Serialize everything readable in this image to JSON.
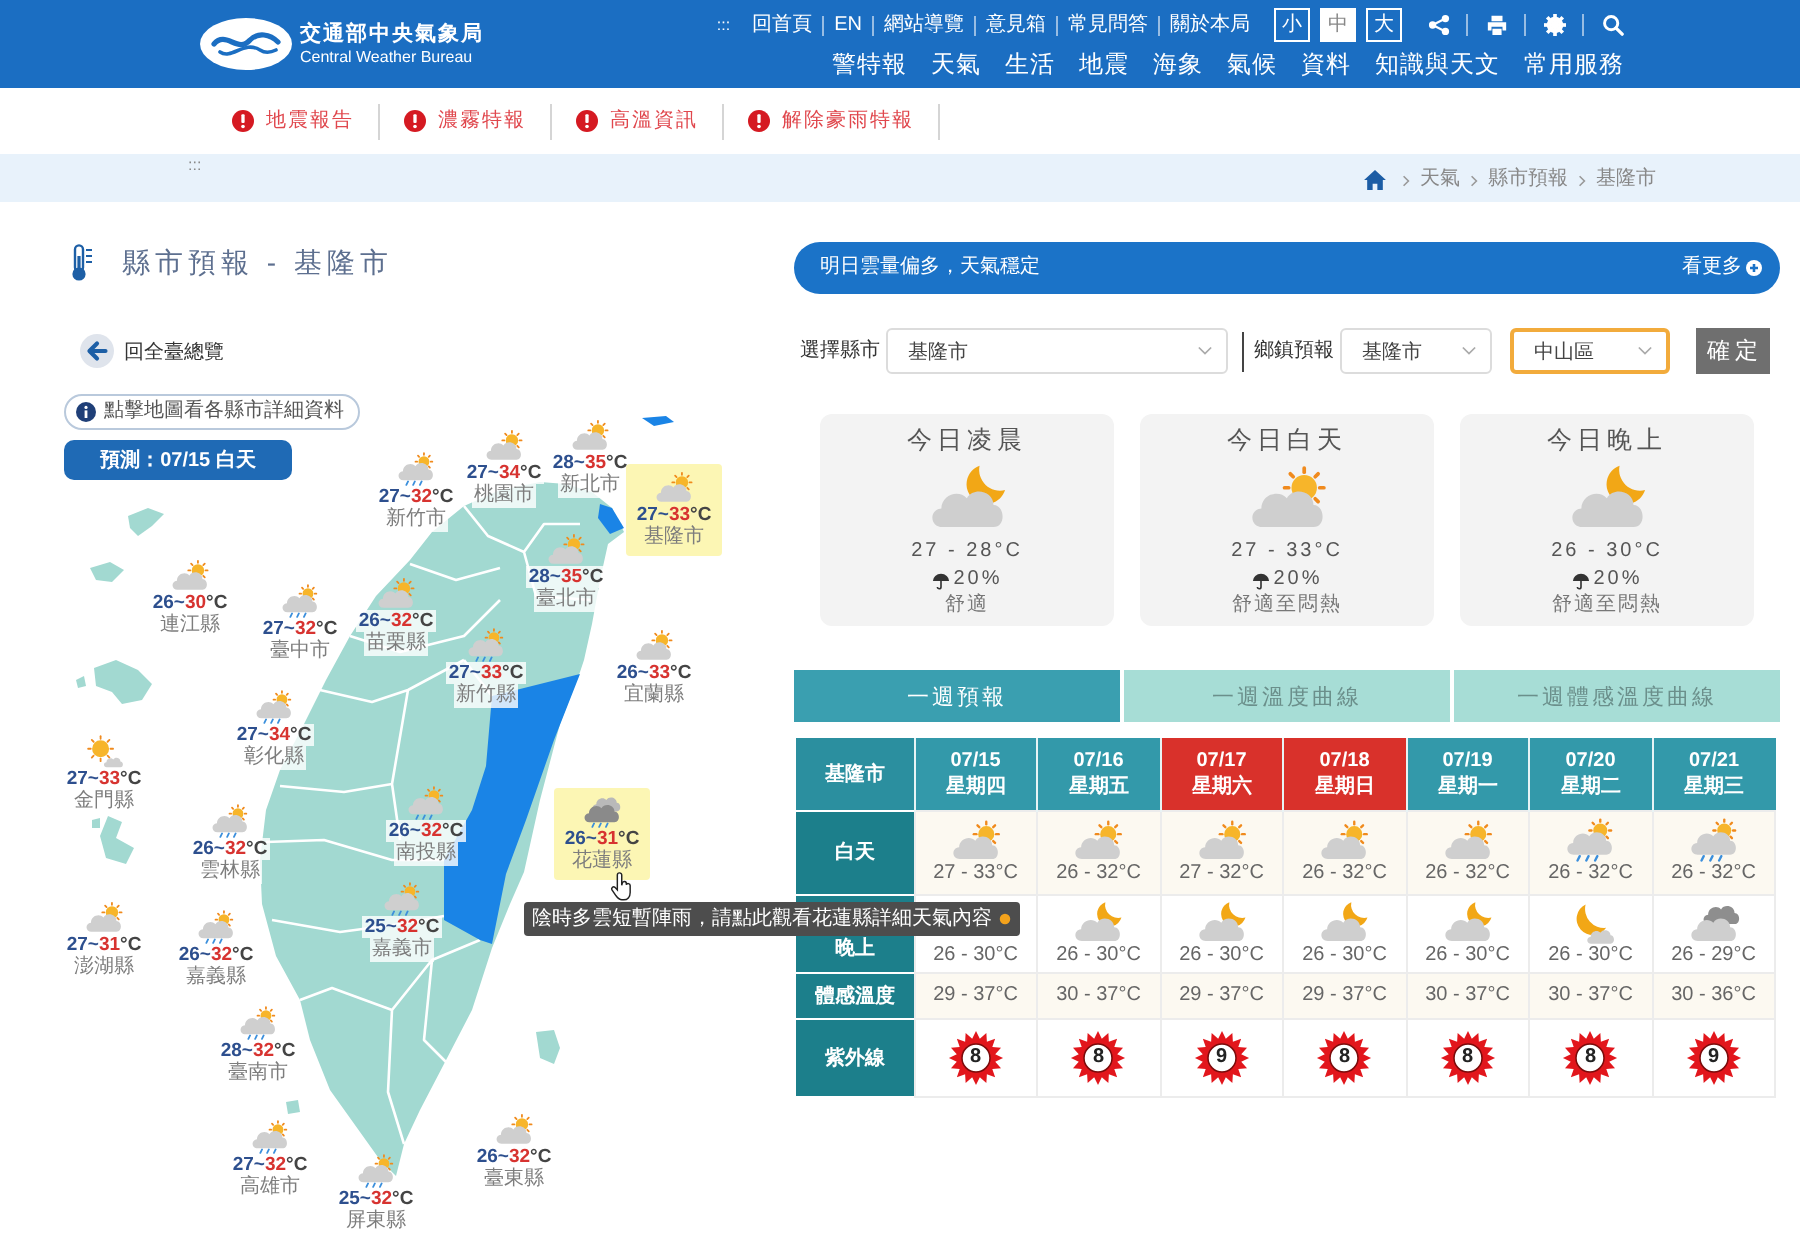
{
  "header": {
    "logo": {
      "name": "交通部中央氣象局",
      "name_en": "Central Weather Bureau"
    },
    "anchor": ":::",
    "utility_links": [
      "回首頁",
      "EN",
      "網站導覽",
      "意見箱",
      "常見問答",
      "關於本局"
    ],
    "font_sizes": [
      {
        "label": "小",
        "selected": false
      },
      {
        "label": "中",
        "selected": true
      },
      {
        "label": "大",
        "selected": false
      }
    ],
    "nav": [
      "警特報",
      "天氣",
      "生活",
      "地震",
      "海象",
      "氣候",
      "資料",
      "知識與天文",
      "常用服務"
    ]
  },
  "alerts": [
    "地震報告",
    "濃霧特報",
    "高溫資訊",
    "解除豪雨特報"
  ],
  "breadcrumb": {
    "anchor": ":::",
    "items": [
      "天氣",
      "縣市預報",
      "基隆市"
    ]
  },
  "county_panel": {
    "title": "縣市預報 - 基隆市",
    "back_link": "回全臺總覽",
    "hint": "點擊地圖看各縣市詳細資料",
    "forecast_time": "預測：07/15 白天"
  },
  "map": {
    "counties": [
      {
        "name": "桃園市",
        "kind": "sun-cloud",
        "low": "27~",
        "high": "34",
        "unit": "°C",
        "highlighted": false
      },
      {
        "name": "新北市",
        "kind": "sun-cloud",
        "low": "28~",
        "high": "35",
        "unit": "°C",
        "highlighted": false
      },
      {
        "name": "新竹市",
        "kind": "rain",
        "low": "27~",
        "high": "32",
        "unit": "°C",
        "highlighted": false
      },
      {
        "name": "基隆市",
        "kind": "sun-cloud",
        "low": "27~",
        "high": "33",
        "unit": "°C",
        "highlighted": true
      },
      {
        "name": "臺北市",
        "kind": "sun-cloud",
        "low": "28~",
        "high": "35",
        "unit": "°C",
        "highlighted": false
      },
      {
        "name": "連江縣",
        "kind": "sun-cloud",
        "low": "26~",
        "high": "30",
        "unit": "°C",
        "highlighted": false
      },
      {
        "name": "臺中市",
        "kind": "rain",
        "low": "27~",
        "high": "32",
        "unit": "°C",
        "highlighted": false
      },
      {
        "name": "苗栗縣",
        "kind": "sun-cloud",
        "low": "26~",
        "high": "32",
        "unit": "°C",
        "highlighted": false
      },
      {
        "name": "新竹縣",
        "kind": "rain",
        "low": "27~",
        "high": "33",
        "unit": "°C",
        "highlighted": false
      },
      {
        "name": "宜蘭縣",
        "kind": "sun-cloud",
        "low": "26~",
        "high": "33",
        "unit": "°C",
        "highlighted": false
      },
      {
        "name": "彰化縣",
        "kind": "rain",
        "low": "27~",
        "high": "34",
        "unit": "°C",
        "highlighted": false
      },
      {
        "name": "金門縣",
        "kind": "sunny",
        "low": "27~",
        "high": "33",
        "unit": "°C",
        "highlighted": false
      },
      {
        "name": "雲林縣",
        "kind": "rain",
        "low": "26~",
        "high": "32",
        "unit": "°C",
        "highlighted": false
      },
      {
        "name": "南投縣",
        "kind": "rain",
        "low": "26~",
        "high": "32",
        "unit": "°C",
        "highlighted": false
      },
      {
        "name": "花蓮縣",
        "kind": "shower",
        "low": "26~",
        "high": "31",
        "unit": "°C",
        "highlighted": true
      },
      {
        "name": "澎湖縣",
        "kind": "sun-cloud",
        "low": "27~",
        "high": "31",
        "unit": "°C",
        "highlighted": false
      },
      {
        "name": "嘉義市",
        "kind": "rain",
        "low": "25~",
        "high": "32",
        "unit": "°C",
        "highlighted": false
      },
      {
        "name": "嘉義縣",
        "kind": "rain",
        "low": "26~",
        "high": "32",
        "unit": "°C",
        "highlighted": false
      },
      {
        "name": "臺南市",
        "kind": "rain",
        "low": "28~",
        "high": "32",
        "unit": "°C",
        "highlighted": false
      },
      {
        "name": "高雄市",
        "kind": "rain",
        "low": "27~",
        "high": "32",
        "unit": "°C",
        "highlighted": false
      },
      {
        "name": "臺東縣",
        "kind": "sun-cloud",
        "low": "26~",
        "high": "32",
        "unit": "°C",
        "highlighted": false
      },
      {
        "name": "屏東縣",
        "kind": "rain",
        "low": "25~",
        "high": "32",
        "unit": "°C",
        "highlighted": false
      }
    ],
    "tooltip": "陰時多雲短暫陣雨，請點此觀看花蓮縣詳細天氣內容"
  },
  "summary": {
    "text": "明日雲量偏多，天氣穩定",
    "more": "看更多"
  },
  "filters": {
    "county_label": "選擇縣市",
    "county": "基隆市",
    "town_label": "鄉鎮預報",
    "town_county": "基隆市",
    "town": "中山區",
    "town_focused": true,
    "submit": "確定"
  },
  "today": [
    {
      "title": "今日凌晨",
      "kind": "moon-cloud",
      "temp": "27 - 28°C",
      "rain": "20%",
      "comfort": "舒適"
    },
    {
      "title": "今日白天",
      "kind": "sun-cloud",
      "temp": "27 - 33°C",
      "rain": "20%",
      "comfort": "舒適至悶熱"
    },
    {
      "title": "今日晚上",
      "kind": "moon-cloud",
      "temp": "26 - 30°C",
      "rain": "20%",
      "comfort": "舒適至悶熱"
    }
  ],
  "week": {
    "tabs": [
      {
        "label": "一週預報",
        "selected": true
      },
      {
        "label": "一週溫度曲線",
        "selected": false
      },
      {
        "label": "一週體感溫度曲線",
        "selected": false
      }
    ],
    "table": {
      "corner": "基隆市",
      "row_labels": [
        "白天",
        "晚上",
        "體感溫度",
        "紫外線"
      ],
      "days": [
        {
          "date": "07/15",
          "weekday": "星期四",
          "weekend": false,
          "day": {
            "kind": "sun-cloud",
            "temp": "27 - 33°C"
          },
          "night": {
            "temp": "26 - 30°C"
          },
          "feels": "29 - 37°C",
          "uv": "8"
        },
        {
          "date": "07/16",
          "weekday": "星期五",
          "weekend": false,
          "day": {
            "kind": "sun-cloud",
            "temp": "26 - 32°C"
          },
          "night": {
            "kind": "moon-cloud",
            "temp": "26 - 30°C"
          },
          "feels": "30 - 37°C",
          "uv": "8"
        },
        {
          "date": "07/17",
          "weekday": "星期六",
          "weekend": true,
          "day": {
            "kind": "sun-cloud",
            "temp": "27 - 32°C"
          },
          "night": {
            "kind": "moon-cloud",
            "temp": "26 - 30°C"
          },
          "feels": "29 - 37°C",
          "uv": "9"
        },
        {
          "date": "07/18",
          "weekday": "星期日",
          "weekend": true,
          "day": {
            "kind": "sun-cloud",
            "temp": "26 - 32°C"
          },
          "night": {
            "kind": "moon-cloud",
            "temp": "26 - 30°C"
          },
          "feels": "29 - 37°C",
          "uv": "8"
        },
        {
          "date": "07/19",
          "weekday": "星期一",
          "weekend": false,
          "day": {
            "kind": "sun-cloud",
            "temp": "26 - 32°C"
          },
          "night": {
            "kind": "moon-cloud",
            "temp": "26 - 30°C"
          },
          "feels": "30 - 37°C",
          "uv": "8"
        },
        {
          "date": "07/20",
          "weekday": "星期二",
          "weekend": false,
          "day": {
            "kind": "rain",
            "temp": "26 - 32°C"
          },
          "night": {
            "kind": "moon",
            "temp": "26 - 30°C"
          },
          "feels": "30 - 37°C",
          "uv": "8"
        },
        {
          "date": "07/21",
          "weekday": "星期三",
          "weekend": false,
          "day": {
            "kind": "rain",
            "temp": "26 - 32°C"
          },
          "night": {
            "kind": "overcast",
            "temp": "26 - 29°C"
          },
          "feels": "30 - 36°C",
          "uv": "9"
        }
      ]
    }
  }
}
